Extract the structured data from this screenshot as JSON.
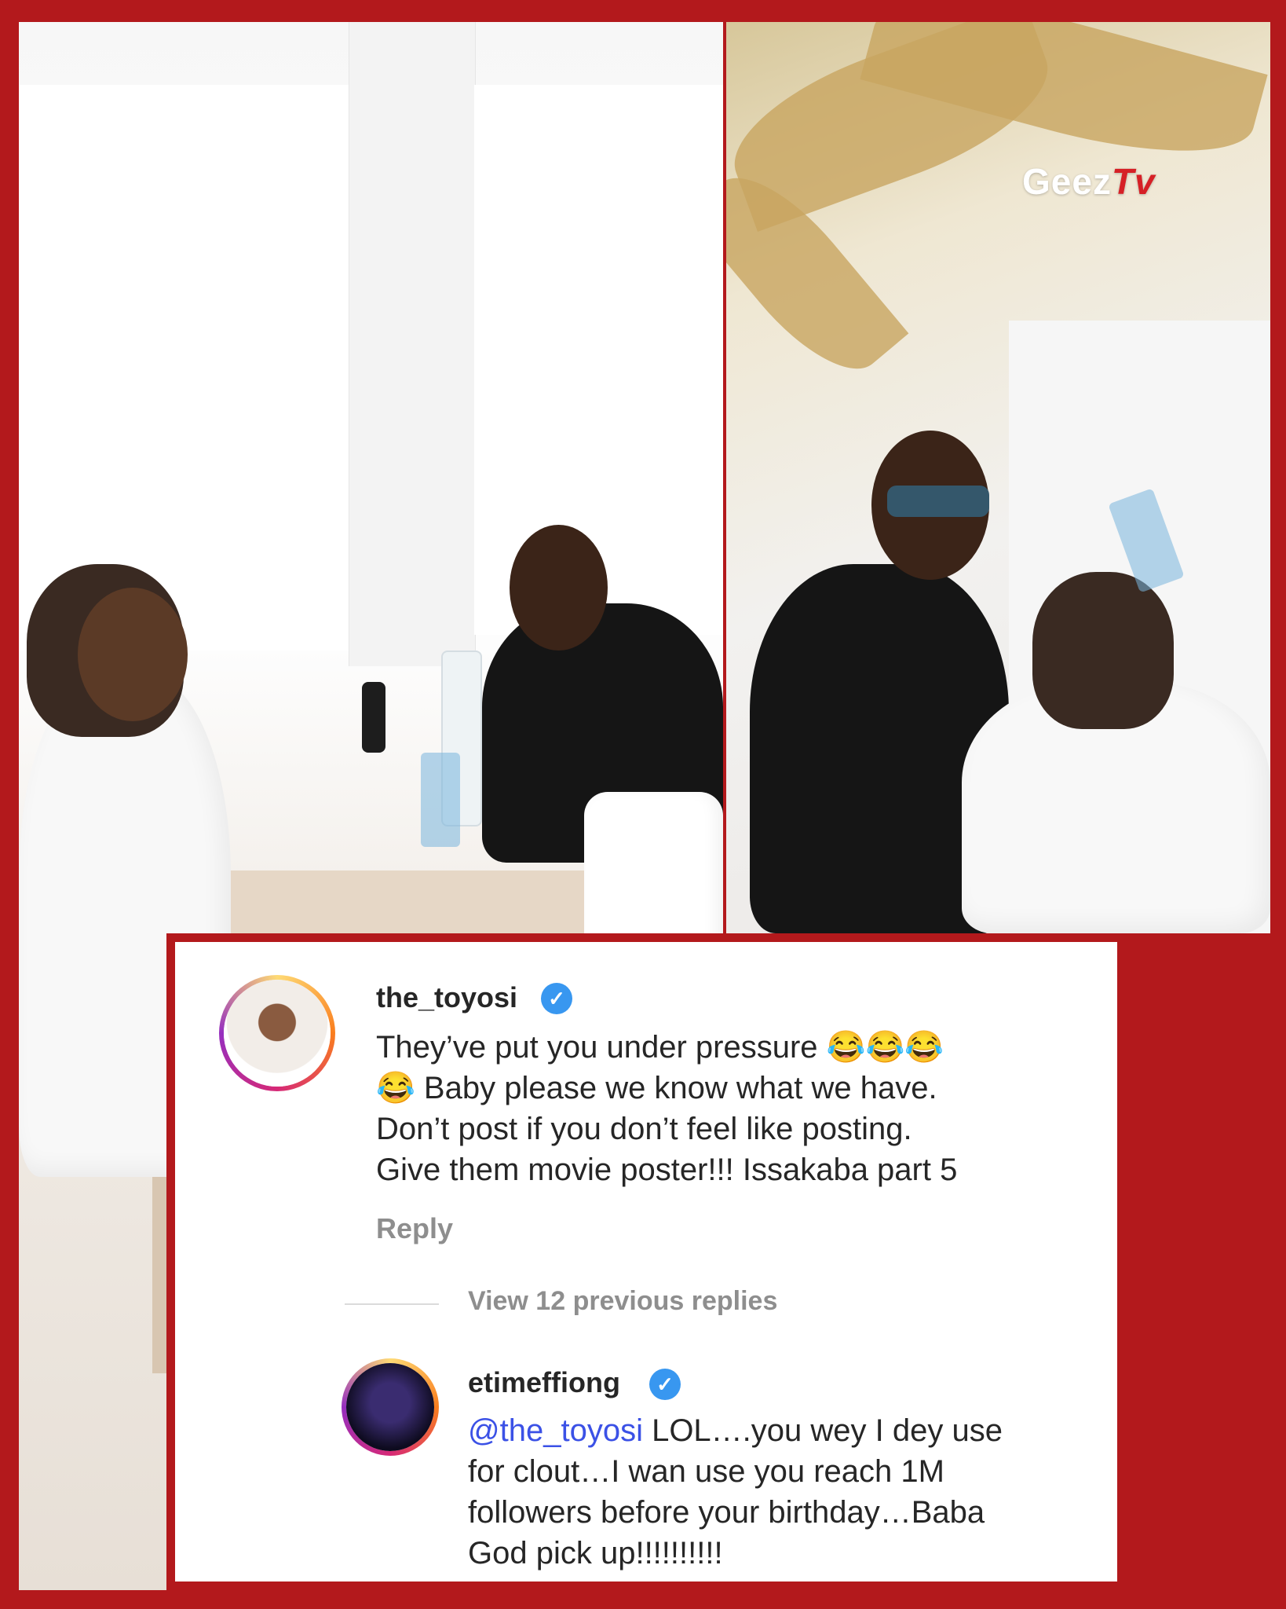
{
  "watermark": {
    "brand": "Geez",
    "suffix": "Tv"
  },
  "comments": [
    {
      "username": "the_toyosi",
      "verified": true,
      "text_line1": "They’ve put you under pressure 😂😂😂",
      "text_line2": "😂 Baby please we know what we have.",
      "text_line3": "Don’t post if you don’t feel like posting.",
      "text_line4": "Give them movie poster!!! Issakaba part 5",
      "reply_label": "Reply"
    },
    {
      "username": "etimeffiong",
      "verified": true,
      "mention": "@the_toyosi",
      "text_line1_rest": " LOL….you wey I dey use",
      "text_line2": "for clout…I wan use you reach 1M",
      "text_line3": "followers before your birthday…Baba",
      "text_line4": "God pick up!!!!!!!!!!"
    }
  ],
  "view_replies": "View 12 previous replies",
  "colors": {
    "frame": "#b3191c",
    "mention": "#3b51e6",
    "verified": "#3897f0"
  }
}
